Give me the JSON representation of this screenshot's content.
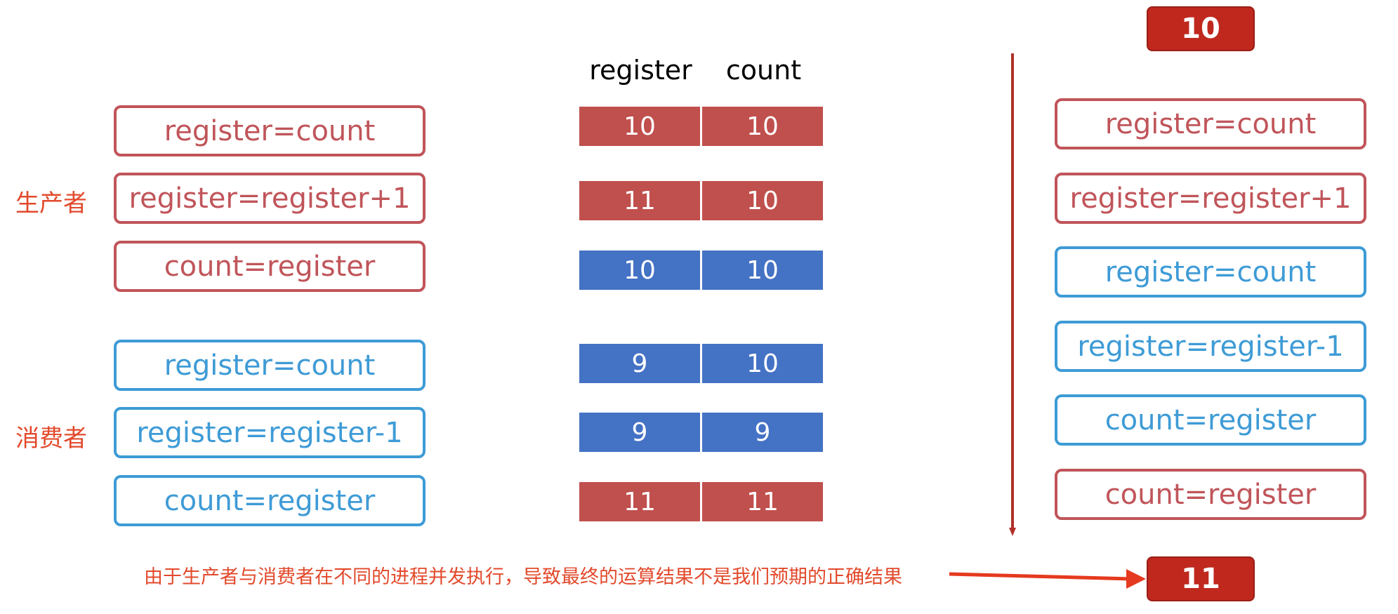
{
  "producer": {
    "label": "生产者",
    "steps": [
      "register=count",
      "register=register+1",
      "count=register"
    ]
  },
  "consumer": {
    "label": "消费者",
    "steps": [
      "register=count",
      "register=register-1",
      "count=register"
    ]
  },
  "table": {
    "headers": [
      "register",
      "count"
    ],
    "rows": [
      {
        "register": "10",
        "count": "10",
        "color": "red"
      },
      {
        "register": "11",
        "count": "10",
        "color": "red"
      },
      {
        "register": "10",
        "count": "10",
        "color": "blue"
      },
      {
        "register": "9",
        "count": "10",
        "color": "blue"
      },
      {
        "register": "9",
        "count": "9",
        "color": "blue"
      },
      {
        "register": "11",
        "count": "11",
        "color": "red"
      }
    ]
  },
  "interleaved": {
    "start_value": "10",
    "steps": [
      {
        "text": "register=count",
        "color": "red"
      },
      {
        "text": "register=register+1",
        "color": "red"
      },
      {
        "text": "register=count",
        "color": "blue"
      },
      {
        "text": "register=register-1",
        "color": "blue"
      },
      {
        "text": "count=register",
        "color": "blue"
      },
      {
        "text": "count=register",
        "color": "red"
      }
    ],
    "end_value": "11"
  },
  "caption": "由于生产者与消费者在不同的进程并发执行，导致最终的运算结果不是我们预期的正确结果",
  "colors": {
    "producer": "#c0555a",
    "consumer": "#3e9bd6",
    "cell_red": "#c0504d",
    "cell_blue": "#4472c4",
    "badge": "#c0281e",
    "caption": "#e24a2c",
    "timeline": "#b0302a"
  }
}
